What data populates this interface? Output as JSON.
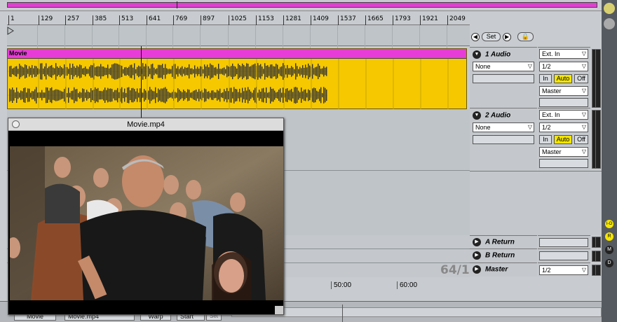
{
  "ruler": {
    "ticks": [
      "1",
      "129",
      "257",
      "385",
      "513",
      "641",
      "769",
      "897",
      "1025",
      "1153",
      "1281",
      "1409",
      "1537",
      "1665",
      "1793",
      "1921",
      "2049"
    ]
  },
  "nav": {
    "back_icon": "left-arrow",
    "set_label": "Set",
    "forward_icon": "right-arrow",
    "lock_icon": "lock"
  },
  "clip": {
    "name": "Movie",
    "color": "#f5c800",
    "header_color": "#e83cd8"
  },
  "tracks": [
    {
      "name": "1 Audio",
      "input_type": "Ext. In",
      "input_channel": "1/2",
      "input_source": "None",
      "monitor": [
        "In",
        "Auto",
        "Off"
      ],
      "monitor_active": "Auto",
      "output": "Master"
    },
    {
      "name": "2 Audio",
      "input_type": "Ext. In",
      "input_channel": "1/2",
      "input_source": "None",
      "monitor": [
        "In",
        "Auto",
        "Off"
      ],
      "monitor_active": "Auto",
      "output": "Master"
    }
  ],
  "returns": [
    {
      "name": "A Return"
    },
    {
      "name": "B Return"
    },
    {
      "name": "Master",
      "output": "1/2"
    }
  ],
  "counter": "64/1",
  "bottom_timeline": [
    "50:00",
    "60:00"
  ],
  "movie_window": {
    "title": "Movie.mp4"
  },
  "bottom_tags": {
    "clip": "Movie",
    "file": "Movie.mp4",
    "warp": "Warp",
    "start": "Start",
    "set": "Set"
  },
  "edge_buttons": [
    "I-O",
    "R",
    "M",
    "D"
  ],
  "accent": "#f5e600"
}
